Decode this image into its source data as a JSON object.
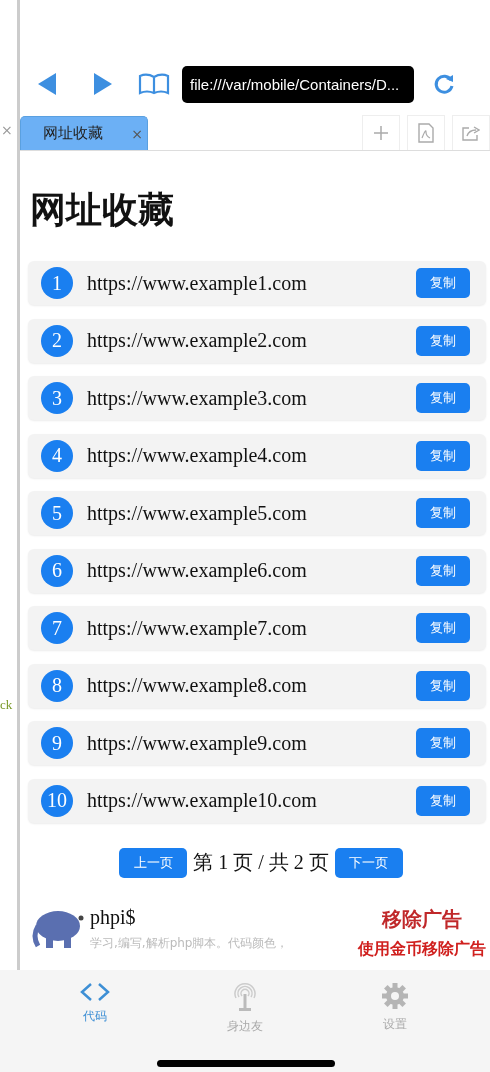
{
  "left_panel": {
    "close": "×",
    "text": "ck"
  },
  "toolbar": {
    "address": "file:///var/mobile/Containers/D..."
  },
  "tabs": [
    {
      "label": "网址收藏",
      "close": "×",
      "selected": true
    }
  ],
  "page": {
    "title": "网址收藏",
    "links": [
      {
        "number": "1",
        "url": "https://www.example1.com",
        "button": "复制"
      },
      {
        "number": "2",
        "url": "https://www.example2.com",
        "button": "复制"
      },
      {
        "number": "3",
        "url": "https://www.example3.com",
        "button": "复制"
      },
      {
        "number": "4",
        "url": "https://www.example4.com",
        "button": "复制"
      },
      {
        "number": "5",
        "url": "https://www.example5.com",
        "button": "复制"
      },
      {
        "number": "6",
        "url": "https://www.example6.com",
        "button": "复制"
      },
      {
        "number": "7",
        "url": "https://www.example7.com",
        "button": "复制"
      },
      {
        "number": "8",
        "url": "https://www.example8.com",
        "button": "复制"
      },
      {
        "number": "9",
        "url": "https://www.example9.com",
        "button": "复制"
      },
      {
        "number": "10",
        "url": "https://www.example10.com",
        "button": "复制"
      }
    ],
    "pagination": {
      "prev": "上一页",
      "status": "第 1 页 / 共 2 页",
      "next": "下一页"
    }
  },
  "ad": {
    "name": "phpi$",
    "description": "学习,编写,解析php脚本。代码颜色，",
    "remove": "移除广告",
    "remove_coins": "使用金币移除广告"
  },
  "bottom_tabs": [
    {
      "label": "代码",
      "selected": true
    },
    {
      "label": "身边友",
      "selected": false
    },
    {
      "label": "设置",
      "selected": false
    }
  ]
}
